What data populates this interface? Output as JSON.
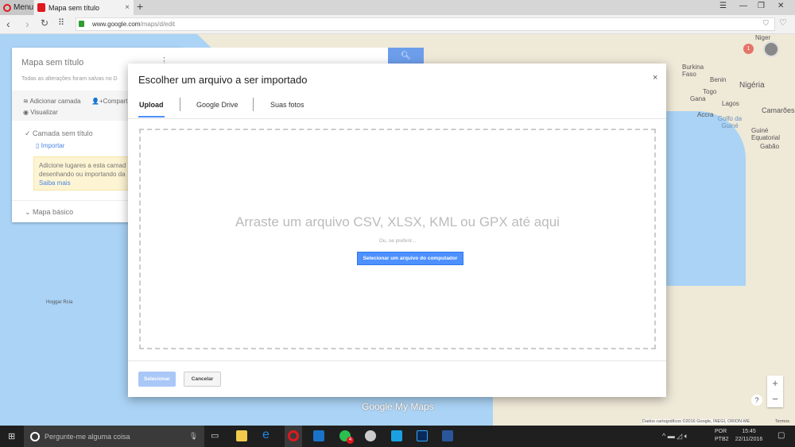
{
  "browser": {
    "menu_label": "Menu",
    "tab_title": "Mapa sem título",
    "tab_close": "×",
    "new_tab": "+",
    "url_host": "www.google.com",
    "url_path": "/maps/d/edit"
  },
  "map": {
    "labels": [
      "Niger",
      "Burkina Faso",
      "Benin",
      "Nigéria",
      "Togo",
      "Gana",
      "Lagos",
      "Accra",
      "Golfo da Guiné",
      "Camarões",
      "Guiné Equatorial",
      "Gabão",
      "Hoggar Rcia"
    ],
    "notification_count": "1",
    "watermark": "Google My Maps",
    "attribution": "Dados cartográficos ©2016 Google, INEGI, ORION-ME",
    "terms": "Termos",
    "zoom_in": "+",
    "zoom_out": "−",
    "help": "?"
  },
  "sidebar": {
    "title": "Mapa sem título",
    "subtitle": "Todas as alterações foram salvas no D",
    "add_layer": "Adicionar camada",
    "share": "Compart",
    "preview": "Visualizar",
    "layer_name": "Camada sem título",
    "import": "Importar",
    "hint_line1": "Adicione lugares a esta camad",
    "hint_line2": "desenhando ou importando da",
    "learn_more": "Saiba mais",
    "base_map": "Mapa básico"
  },
  "dialog": {
    "title": "Escolher um arquivo a ser importado",
    "close": "×",
    "tabs": [
      "Upload",
      "Google Drive",
      "Suas fotos"
    ],
    "drop_text": "Arraste um arquivo CSV, XLSX, KML ou GPX até aqui",
    "or_text": "Ou, se preferir...",
    "select_file": "Selecionar um arquivo do computador",
    "select_btn": "Selecionar",
    "cancel_btn": "Cancelar"
  },
  "taskbar": {
    "search_placeholder": "Pergunte-me alguma coisa",
    "lang1": "POR",
    "lang2": "PTB2",
    "time": "15:45",
    "date": "22/11/2016",
    "whatsapp_badge": "4"
  }
}
